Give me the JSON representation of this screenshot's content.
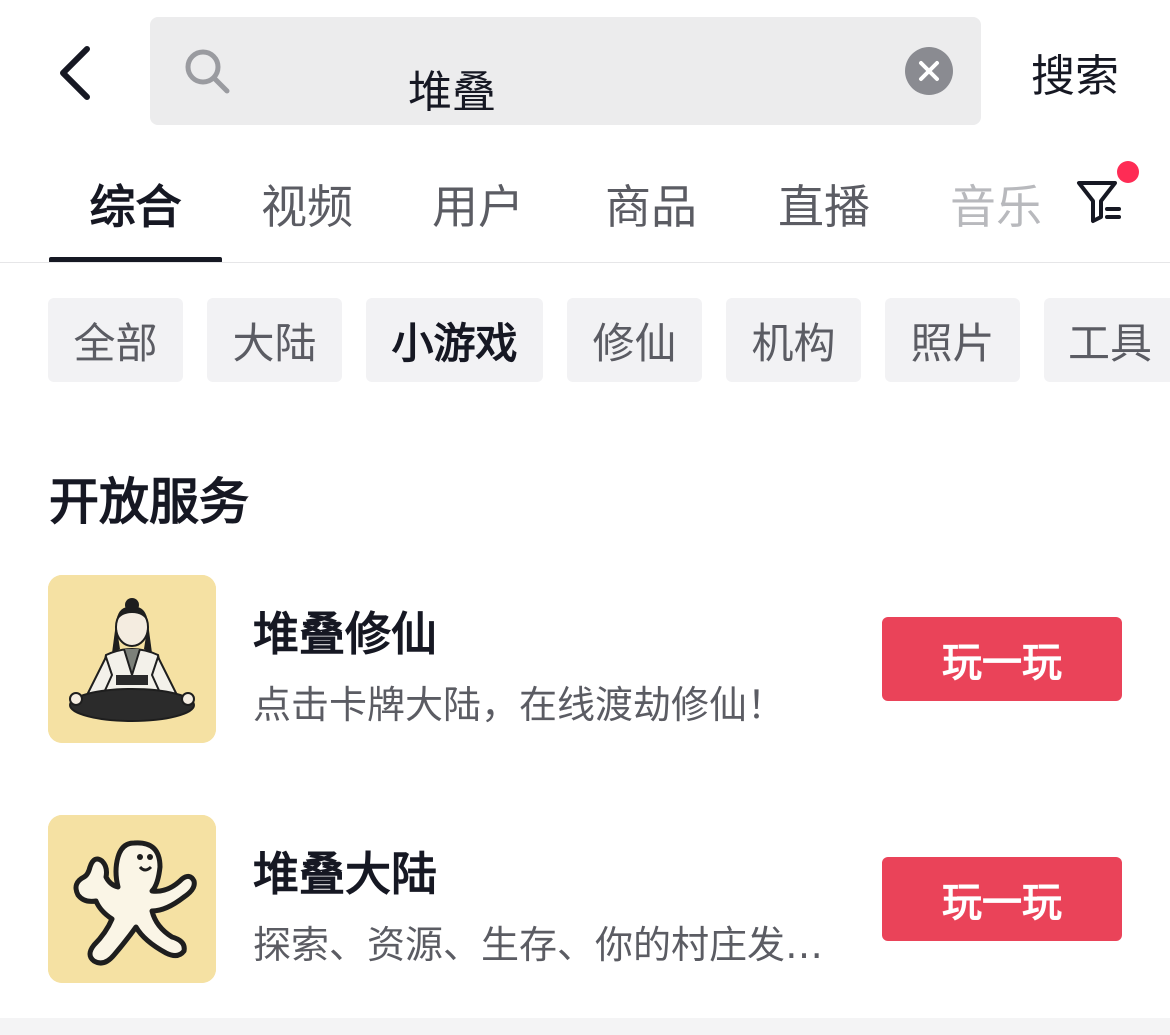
{
  "search": {
    "query": "堆叠",
    "submit_label": "搜索"
  },
  "tabs": [
    {
      "label": "综合",
      "active": true
    },
    {
      "label": "视频"
    },
    {
      "label": "用户"
    },
    {
      "label": "商品"
    },
    {
      "label": "直播"
    },
    {
      "label": "音乐"
    }
  ],
  "chips": [
    {
      "label": "全部"
    },
    {
      "label": "大陆"
    },
    {
      "label": "小游戏",
      "active": true
    },
    {
      "label": "修仙"
    },
    {
      "label": "机构"
    },
    {
      "label": "照片"
    },
    {
      "label": "工具"
    }
  ],
  "section": {
    "title": "开放服务"
  },
  "items": [
    {
      "title": "堆叠修仙",
      "desc": "点击卡牌大陆，在线渡劫修仙！",
      "button": "玩一玩",
      "icon": "meditating-cultivator-icon"
    },
    {
      "title": "堆叠大陆",
      "desc": "探索、资源、生存、你的村庄发展…",
      "button": "玩一玩",
      "icon": "dancing-doodle-figure-icon"
    }
  ],
  "colors": {
    "accent": "#ea4359",
    "text_primary": "#161823",
    "text_secondary": "#5b5c63",
    "chip_bg": "#f2f2f4",
    "thumb_bg": "#f5e1a3",
    "badge_dot": "#fe2c55"
  }
}
